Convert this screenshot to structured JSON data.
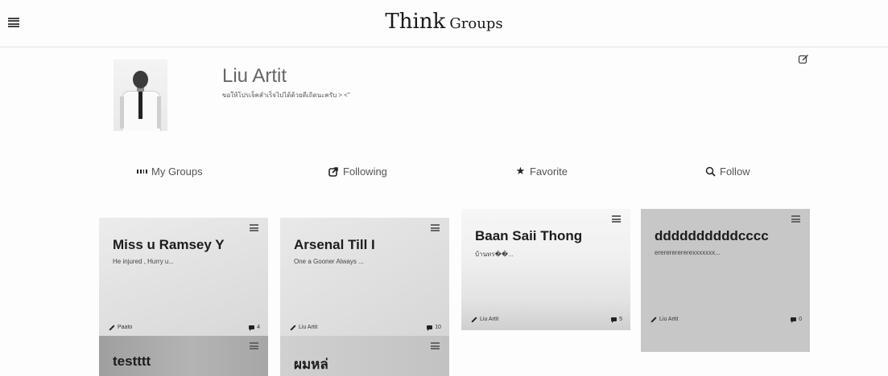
{
  "header": {
    "brand_big": "Think",
    "brand_small": "Groups"
  },
  "profile": {
    "name": "Liu Artit",
    "status": "ขอให้โปรเจ็คสำเร็จไปได้ด้วยดีเถิดนะครับ > <\""
  },
  "nav": [
    {
      "label": "My Groups",
      "icon": "grid-icon"
    },
    {
      "label": "Following",
      "icon": "share-icon"
    },
    {
      "label": "Favorite",
      "icon": "star-icon"
    },
    {
      "label": "Follow",
      "icon": "search-icon"
    }
  ],
  "cards": [
    {
      "title": "Miss u Ramsey Y",
      "desc": "He injured , Hurry u...",
      "author": "Paato",
      "count": "4"
    },
    {
      "title": "Arsenal Till I",
      "desc": "One a Gooner Always ...",
      "author": "Liu Artit",
      "count": "10"
    },
    {
      "title": "Baan Saii Thong",
      "desc": "บ้านทร��...",
      "author": "Liu Artit",
      "count": "5"
    },
    {
      "title": "ddddddddddcccc",
      "desc": "ererererererexxxxxxx...",
      "author": "Liu Artit",
      "count": "0"
    },
    {
      "title": "testttt",
      "desc": "",
      "author": "",
      "count": ""
    },
    {
      "title": "ผมหล่",
      "desc": "",
      "author": "",
      "count": ""
    }
  ]
}
